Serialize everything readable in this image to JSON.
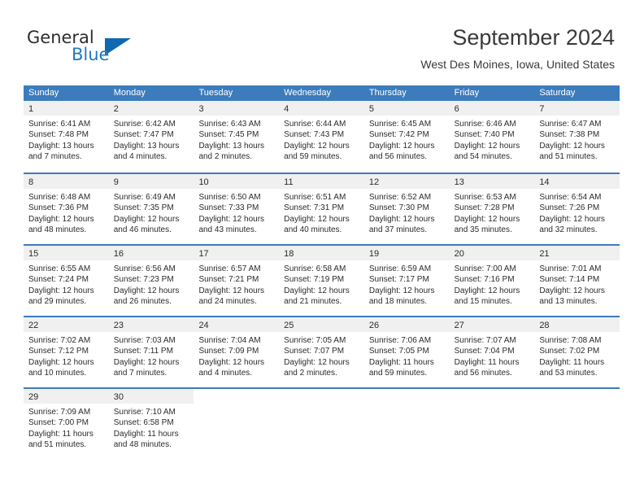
{
  "brand": {
    "name_part1": "General",
    "name_part2": "Blue",
    "accent_color": "#1068b0",
    "logo_icon": "triangle-flag-icon"
  },
  "header": {
    "title": "September 2024",
    "location": "West Des Moines, Iowa, United States"
  },
  "calendar": {
    "header_bg": "#3d7cbc",
    "day_band_bg": "#f0f0f0",
    "weekday_headers": [
      "Sunday",
      "Monday",
      "Tuesday",
      "Wednesday",
      "Thursday",
      "Friday",
      "Saturday"
    ],
    "weeks": [
      [
        {
          "day": "1",
          "lines": [
            "Sunrise: 6:41 AM",
            "Sunset: 7:48 PM",
            "Daylight: 13 hours",
            "and 7 minutes."
          ]
        },
        {
          "day": "2",
          "lines": [
            "Sunrise: 6:42 AM",
            "Sunset: 7:47 PM",
            "Daylight: 13 hours",
            "and 4 minutes."
          ]
        },
        {
          "day": "3",
          "lines": [
            "Sunrise: 6:43 AM",
            "Sunset: 7:45 PM",
            "Daylight: 13 hours",
            "and 2 minutes."
          ]
        },
        {
          "day": "4",
          "lines": [
            "Sunrise: 6:44 AM",
            "Sunset: 7:43 PM",
            "Daylight: 12 hours",
            "and 59 minutes."
          ]
        },
        {
          "day": "5",
          "lines": [
            "Sunrise: 6:45 AM",
            "Sunset: 7:42 PM",
            "Daylight: 12 hours",
            "and 56 minutes."
          ]
        },
        {
          "day": "6",
          "lines": [
            "Sunrise: 6:46 AM",
            "Sunset: 7:40 PM",
            "Daylight: 12 hours",
            "and 54 minutes."
          ]
        },
        {
          "day": "7",
          "lines": [
            "Sunrise: 6:47 AM",
            "Sunset: 7:38 PM",
            "Daylight: 12 hours",
            "and 51 minutes."
          ]
        }
      ],
      [
        {
          "day": "8",
          "lines": [
            "Sunrise: 6:48 AM",
            "Sunset: 7:36 PM",
            "Daylight: 12 hours",
            "and 48 minutes."
          ]
        },
        {
          "day": "9",
          "lines": [
            "Sunrise: 6:49 AM",
            "Sunset: 7:35 PM",
            "Daylight: 12 hours",
            "and 46 minutes."
          ]
        },
        {
          "day": "10",
          "lines": [
            "Sunrise: 6:50 AM",
            "Sunset: 7:33 PM",
            "Daylight: 12 hours",
            "and 43 minutes."
          ]
        },
        {
          "day": "11",
          "lines": [
            "Sunrise: 6:51 AM",
            "Sunset: 7:31 PM",
            "Daylight: 12 hours",
            "and 40 minutes."
          ]
        },
        {
          "day": "12",
          "lines": [
            "Sunrise: 6:52 AM",
            "Sunset: 7:30 PM",
            "Daylight: 12 hours",
            "and 37 minutes."
          ]
        },
        {
          "day": "13",
          "lines": [
            "Sunrise: 6:53 AM",
            "Sunset: 7:28 PM",
            "Daylight: 12 hours",
            "and 35 minutes."
          ]
        },
        {
          "day": "14",
          "lines": [
            "Sunrise: 6:54 AM",
            "Sunset: 7:26 PM",
            "Daylight: 12 hours",
            "and 32 minutes."
          ]
        }
      ],
      [
        {
          "day": "15",
          "lines": [
            "Sunrise: 6:55 AM",
            "Sunset: 7:24 PM",
            "Daylight: 12 hours",
            "and 29 minutes."
          ]
        },
        {
          "day": "16",
          "lines": [
            "Sunrise: 6:56 AM",
            "Sunset: 7:23 PM",
            "Daylight: 12 hours",
            "and 26 minutes."
          ]
        },
        {
          "day": "17",
          "lines": [
            "Sunrise: 6:57 AM",
            "Sunset: 7:21 PM",
            "Daylight: 12 hours",
            "and 24 minutes."
          ]
        },
        {
          "day": "18",
          "lines": [
            "Sunrise: 6:58 AM",
            "Sunset: 7:19 PM",
            "Daylight: 12 hours",
            "and 21 minutes."
          ]
        },
        {
          "day": "19",
          "lines": [
            "Sunrise: 6:59 AM",
            "Sunset: 7:17 PM",
            "Daylight: 12 hours",
            "and 18 minutes."
          ]
        },
        {
          "day": "20",
          "lines": [
            "Sunrise: 7:00 AM",
            "Sunset: 7:16 PM",
            "Daylight: 12 hours",
            "and 15 minutes."
          ]
        },
        {
          "day": "21",
          "lines": [
            "Sunrise: 7:01 AM",
            "Sunset: 7:14 PM",
            "Daylight: 12 hours",
            "and 13 minutes."
          ]
        }
      ],
      [
        {
          "day": "22",
          "lines": [
            "Sunrise: 7:02 AM",
            "Sunset: 7:12 PM",
            "Daylight: 12 hours",
            "and 10 minutes."
          ]
        },
        {
          "day": "23",
          "lines": [
            "Sunrise: 7:03 AM",
            "Sunset: 7:11 PM",
            "Daylight: 12 hours",
            "and 7 minutes."
          ]
        },
        {
          "day": "24",
          "lines": [
            "Sunrise: 7:04 AM",
            "Sunset: 7:09 PM",
            "Daylight: 12 hours",
            "and 4 minutes."
          ]
        },
        {
          "day": "25",
          "lines": [
            "Sunrise: 7:05 AM",
            "Sunset: 7:07 PM",
            "Daylight: 12 hours",
            "and 2 minutes."
          ]
        },
        {
          "day": "26",
          "lines": [
            "Sunrise: 7:06 AM",
            "Sunset: 7:05 PM",
            "Daylight: 11 hours",
            "and 59 minutes."
          ]
        },
        {
          "day": "27",
          "lines": [
            "Sunrise: 7:07 AM",
            "Sunset: 7:04 PM",
            "Daylight: 11 hours",
            "and 56 minutes."
          ]
        },
        {
          "day": "28",
          "lines": [
            "Sunrise: 7:08 AM",
            "Sunset: 7:02 PM",
            "Daylight: 11 hours",
            "and 53 minutes."
          ]
        }
      ],
      [
        {
          "day": "29",
          "lines": [
            "Sunrise: 7:09 AM",
            "Sunset: 7:00 PM",
            "Daylight: 11 hours",
            "and 51 minutes."
          ]
        },
        {
          "day": "30",
          "lines": [
            "Sunrise: 7:10 AM",
            "Sunset: 6:58 PM",
            "Daylight: 11 hours",
            "and 48 minutes."
          ]
        },
        {
          "day": "",
          "lines": []
        },
        {
          "day": "",
          "lines": []
        },
        {
          "day": "",
          "lines": []
        },
        {
          "day": "",
          "lines": []
        },
        {
          "day": "",
          "lines": []
        }
      ]
    ]
  }
}
